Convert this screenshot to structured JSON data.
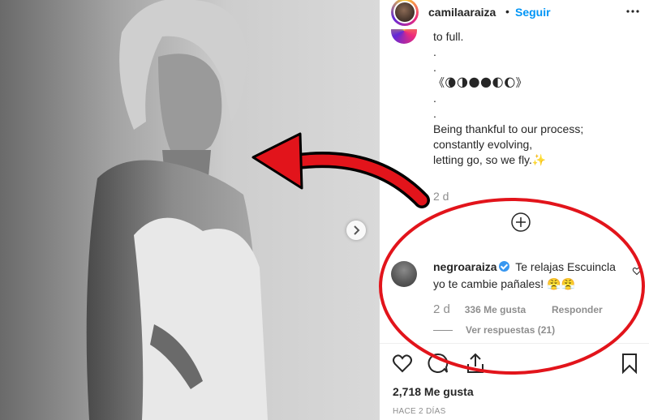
{
  "post": {
    "username": "camilaaraiza",
    "separator": "•",
    "follow_label": "Seguir",
    "caption_lines": [
      "to full.",
      ".",
      ".",
      "《🌘🌗🌑🌑🌓🌔》",
      ".",
      ".",
      "Being thankful to our process;",
      "constantly evolving,",
      "letting go, so we fly.✨"
    ],
    "caption_time": "2 d",
    "likes_label": "2,718 Me gusta",
    "time_ago": "HACE 2 DÍAS"
  },
  "comment": {
    "username": "negroaraiza",
    "text_line1": "Te relajas Escuincla",
    "text_line2": "yo te cambie pañales! 😤😤",
    "time": "2 d",
    "likes": "336 Me gusta",
    "reply_label": "Responder",
    "view_replies": "Ver respuestas (21)"
  },
  "icons": {
    "more": "more-options-icon",
    "load_more": "plus-circle-icon",
    "like": "heart-icon",
    "comment": "comment-icon",
    "share": "share-icon",
    "save": "bookmark-icon",
    "carousel": "chevron-right-icon",
    "verified": "verified-badge-icon"
  },
  "colors": {
    "link_blue": "#0095f6",
    "annotation_red": "#e2141b",
    "muted_text": "#8e8e8e"
  }
}
